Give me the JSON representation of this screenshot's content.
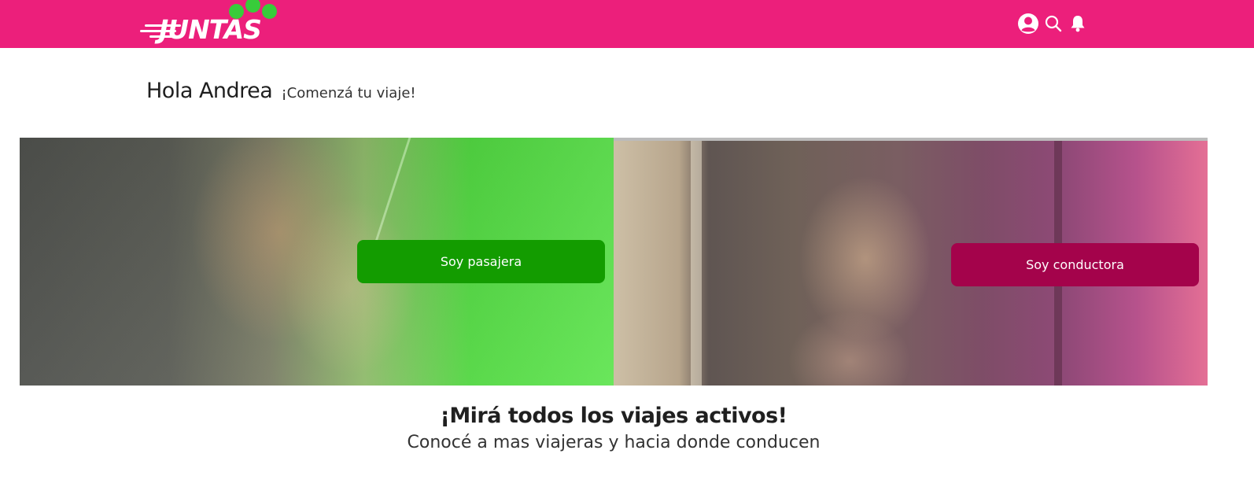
{
  "header": {
    "logo_text": "JUNTAS",
    "background_color": "#ec1f7b",
    "logo_dot_color": "#38cc3a",
    "icons": [
      "user-icon",
      "search-icon",
      "bell-icon"
    ]
  },
  "greeting": {
    "title": "Hola Andrea",
    "subtitle": "¡Comenzá tu viaje!"
  },
  "panels": [
    {
      "button_label": "Soy pasajera",
      "button_color": "#139c00",
      "overlay": "green"
    },
    {
      "button_label": "Soy conductora",
      "button_color": "#a4034b",
      "overlay": "magenta"
    }
  ],
  "active_trips": {
    "title": "¡Mirá todos los viajes activos!",
    "subtitle": "Conocé a mas viajeras y hacia donde conducen"
  }
}
